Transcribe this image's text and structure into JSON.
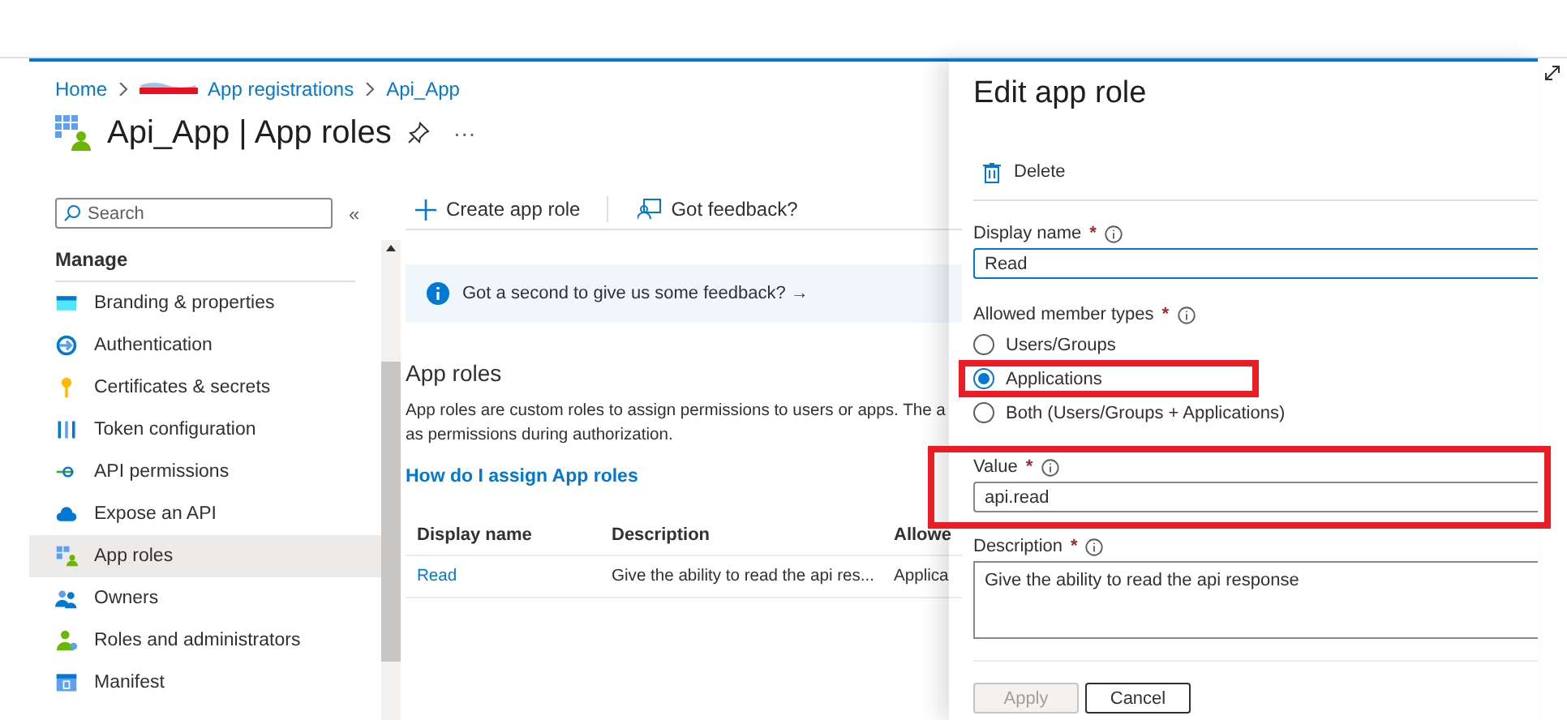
{
  "breadcrumb": [
    {
      "label": "Home",
      "redacted": false
    },
    {
      "label": "App registrations",
      "redacted": true
    },
    {
      "label": "Api_App",
      "redacted": false
    }
  ],
  "header": {
    "title": "Api_App | App roles",
    "more": "···"
  },
  "sidebar": {
    "search": {
      "placeholder": "Search"
    },
    "collapse": "«",
    "section": "Manage",
    "items": [
      {
        "label": "Branding & properties",
        "selected": false
      },
      {
        "label": "Authentication",
        "selected": false
      },
      {
        "label": "Certificates & secrets",
        "selected": false
      },
      {
        "label": "Token configuration",
        "selected": false
      },
      {
        "label": "API permissions",
        "selected": false
      },
      {
        "label": "Expose an API",
        "selected": false
      },
      {
        "label": "App roles",
        "selected": true
      },
      {
        "label": "Owners",
        "selected": false
      },
      {
        "label": "Roles and administrators",
        "selected": false
      },
      {
        "label": "Manifest",
        "selected": false
      }
    ]
  },
  "toolbar": [
    {
      "kind": "create",
      "label": "Create app role"
    },
    {
      "kind": "feedback",
      "label": "Got feedback?"
    }
  ],
  "banner": "Got a second to give us some feedback? →",
  "section": {
    "title": "App roles",
    "description": "App roles are custom roles to assign permissions to users or apps. The a",
    "description_2": "as permissions during authorization.",
    "link": "How do I assign App roles"
  },
  "table": {
    "columns": [
      "Display name",
      "Description",
      "Allowe"
    ],
    "rows": [
      [
        "Read",
        "Give the ability to read the api res...",
        "Applica"
      ]
    ]
  },
  "panel": {
    "title": "Edit app role",
    "delete": "Delete",
    "required_mark": "*",
    "display_name": {
      "label": "Display name",
      "value": "Read"
    },
    "member_types": {
      "label": "Allowed member types",
      "options": [
        {
          "label": "Users/Groups",
          "selected": false
        },
        {
          "label": "Applications",
          "selected": true
        },
        {
          "label": "Both (Users/Groups + Applications)",
          "selected": false
        }
      ]
    },
    "value": {
      "label": "Value",
      "value": "api.read"
    },
    "description": {
      "label": "Description",
      "value": "Give the ability to read the api response"
    },
    "buttons": [
      {
        "kind": "primary",
        "label": "Apply",
        "disabled": true
      },
      {
        "kind": "secondary",
        "label": "Cancel",
        "disabled": false
      }
    ]
  }
}
